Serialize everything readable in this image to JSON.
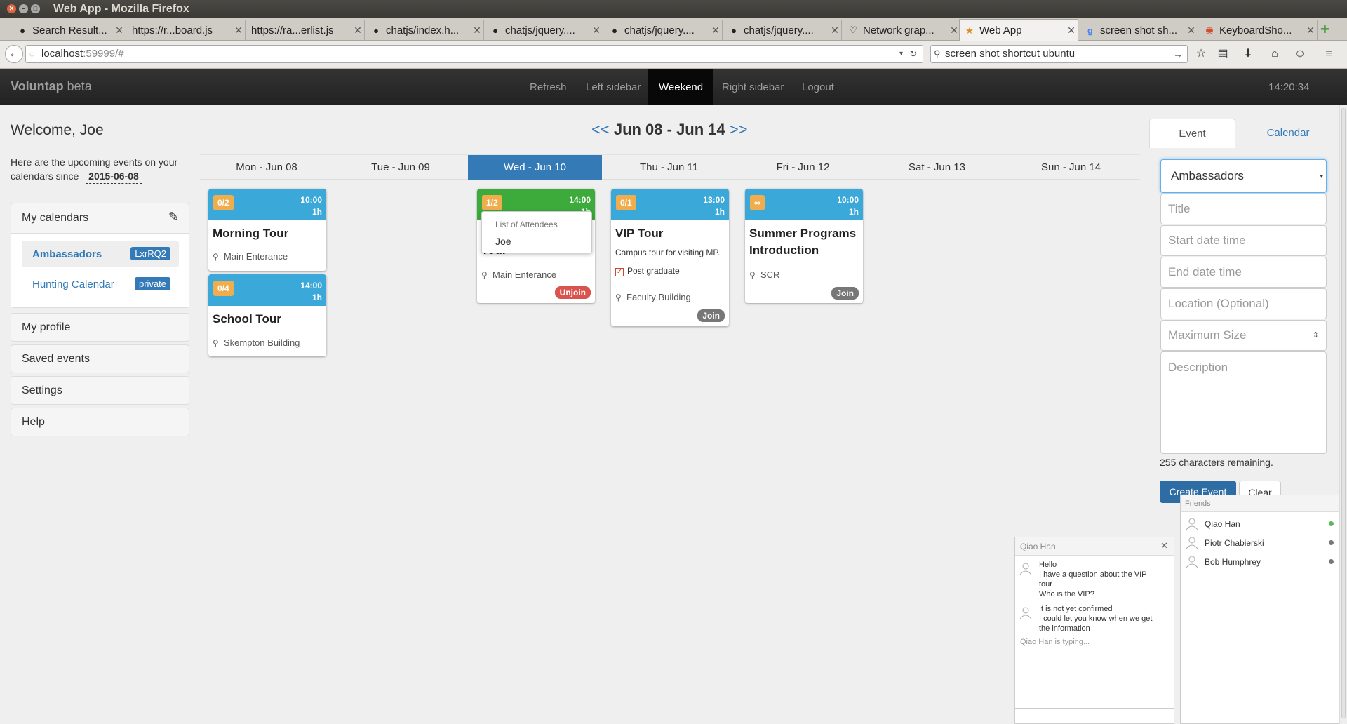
{
  "browser": {
    "window_title": "Web App - Mozilla Firefox",
    "tabs": [
      {
        "label": "Search Result...",
        "icon": "github-icon"
      },
      {
        "label": "https://r...board.js",
        "icon": "none"
      },
      {
        "label": "https://ra...erlist.js",
        "icon": "none"
      },
      {
        "label": "chatjs/index.h...",
        "icon": "github-icon"
      },
      {
        "label": "chatjs/jquery....",
        "icon": "github-icon"
      },
      {
        "label": "chatjs/jquery....",
        "icon": "github-icon"
      },
      {
        "label": "chatjs/jquery....",
        "icon": "github-icon"
      },
      {
        "label": "Network grap...",
        "icon": "network-icon"
      },
      {
        "label": "Web App",
        "icon": "star-icon"
      },
      {
        "label": "screen shot sh...",
        "icon": "google-icon"
      },
      {
        "label": "KeyboardSho...",
        "icon": "chrome-icon"
      }
    ],
    "url_host": "localhost",
    "url_rest": ":59999/#",
    "search_value": "screen shot shortcut ubuntu"
  },
  "app": {
    "brand": "Voluntap",
    "brand_suffix": "beta",
    "nav": [
      "Refresh",
      "Left sidebar",
      "Weekend",
      "Right sidebar",
      "Logout"
    ],
    "active_nav": "Weekend",
    "clock": "14:20:34"
  },
  "sidebar": {
    "welcome": "Welcome, Joe",
    "upcoming_text": "Here are the upcoming events on your calendars since",
    "since_date": "2015-06-08",
    "my_calendars_title": "My calendars",
    "calendars": [
      {
        "name": "Ambassadors",
        "badge": "LxrRQ2",
        "selected": true
      },
      {
        "name": "Hunting Calendar",
        "badge": "private",
        "selected": false
      }
    ],
    "menu": [
      "My profile",
      "Saved events",
      "Settings",
      "Help"
    ]
  },
  "week": {
    "prev": "<<",
    "title": "Jun 08 - Jun 14",
    "next": ">>",
    "days": [
      "Mon - Jun 08",
      "Tue - Jun 09",
      "Wed - Jun 10",
      "Thu - Jun 11",
      "Fri - Jun 12",
      "Sat - Jun 13",
      "Sun - Jun 14"
    ],
    "today": "Wed - Jun 10"
  },
  "events": [
    {
      "count": "0/2",
      "time": "10:00",
      "duration": "1h",
      "title": "Morning Tour",
      "location": "Main Enterance"
    },
    {
      "count": "0/4",
      "time": "14:00",
      "duration": "1h",
      "title": "School Tour",
      "location": "Skempton Building"
    },
    {
      "count": "1/2",
      "time": "14:00",
      "duration": "1h",
      "title": "Tour",
      "location": "Main Enterance",
      "action": "Unjoin",
      "popup_title": "List of Attendees",
      "attendee": "Joe"
    },
    {
      "count": "0/1",
      "time": "13:00",
      "duration": "1h",
      "title": "VIP Tour",
      "description": "Campus tour for visiting MP.",
      "tag": "Post graduate",
      "location": "Faculty Building",
      "action": "Join"
    },
    {
      "count": "∞",
      "time": "10:00",
      "duration": "1h",
      "title_line1": "Summer Programs",
      "title_line2": "Introduction",
      "location": "SCR",
      "action": "Join"
    }
  ],
  "form": {
    "tab_event": "Event",
    "tab_calendar": "Calendar",
    "calendar_select": "Ambassadors",
    "title_ph": "Title",
    "start_ph": "Start date time",
    "end_ph": "End date time",
    "location_ph": "Location (Optional)",
    "max_ph": "Maximum Size",
    "desc_ph": "Description",
    "chars_left": "255 characters remaining.",
    "create": "Create Event",
    "clear": "Clear"
  },
  "friends": {
    "title": "Friends",
    "list": [
      {
        "name": "Qiao Han",
        "status_color": "#5cb85c"
      },
      {
        "name": "Piotr Chabierski",
        "status_color": "#777777"
      },
      {
        "name": "Bob Humphrey",
        "status_color": "#777777"
      }
    ]
  },
  "chat": {
    "title": "Qiao Han",
    "messages": [
      {
        "lines": [
          "Hello",
          "I have a question about the VIP",
          "tour",
          "Who is the VIP?"
        ]
      },
      {
        "lines": [
          "It is not yet confirmed",
          "I could let you know when we get",
          "the information"
        ]
      }
    ],
    "typing": "Qiao Han is typing..."
  },
  "colors": {
    "primary": "#337ab7",
    "event_header": "#3aa8d8",
    "joined_header": "#3cab3c",
    "count_badge": "#f0ad4e",
    "unjoin": "#d9534f",
    "join": "#777777"
  }
}
